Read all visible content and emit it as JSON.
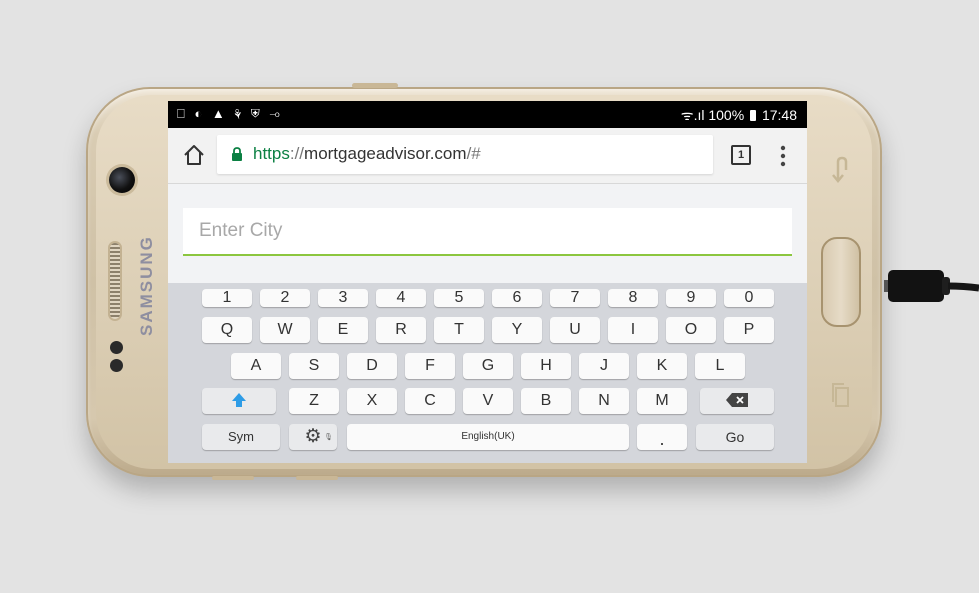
{
  "device": {
    "brand": "SAMSUNG",
    "soft_keys": {
      "back": "back-arrow",
      "recents": "recent-apps"
    }
  },
  "status_bar": {
    "left_icons": [
      "notification-icon",
      "sync-icon",
      "warning-icon",
      "wifi-off-icon",
      "shield-icon",
      "key-icon"
    ],
    "left_glyphs": "⎕ ◐ ▲ ⚘ ⛨ ⊸",
    "signal_glyphs": "ᯤ.ıl",
    "battery": "100%",
    "time": "17:48"
  },
  "browser": {
    "url_scheme": "https",
    "url_sep": "://",
    "url_host": "mortgageadvisor.com",
    "url_path": "/#",
    "tab_count": "1"
  },
  "page": {
    "city_placeholder": "Enter City",
    "city_value": ""
  },
  "keyboard": {
    "row_numbers": [
      "1",
      "2",
      "3",
      "4",
      "5",
      "6",
      "7",
      "8",
      "9",
      "0"
    ],
    "row_top": [
      "Q",
      "W",
      "E",
      "R",
      "T",
      "Y",
      "U",
      "I",
      "O",
      "P"
    ],
    "row_mid": [
      "A",
      "S",
      "D",
      "F",
      "G",
      "H",
      "J",
      "K",
      "L"
    ],
    "row_bottom": [
      "Z",
      "X",
      "C",
      "V",
      "B",
      "N",
      "M"
    ],
    "sym_label": "Sym",
    "space_label": "English(UK)",
    "period_label": ".",
    "go_label": "Go"
  },
  "colors": {
    "accent_green": "#8cc63f",
    "secure_green": "#0b8043",
    "shift_blue": "#2e9ce6"
  }
}
